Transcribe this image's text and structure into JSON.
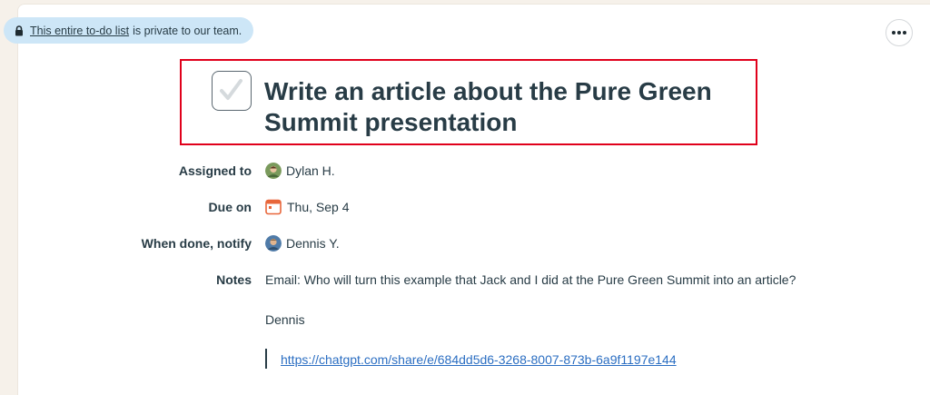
{
  "privacy": {
    "link_text": "This entire to-do list",
    "suffix": "is private to our team."
  },
  "todo": {
    "title": "Write an article about the Pure Green Summit presentation",
    "completed": false
  },
  "fields": {
    "assigned_to": {
      "label": "Assigned to",
      "value": "Dylan H."
    },
    "due_on": {
      "label": "Due on",
      "value": "Thu, Sep 4"
    },
    "notify": {
      "label": "When done, notify",
      "value": "Dennis Y."
    },
    "notes": {
      "label": "Notes",
      "line1": "Email: Who will turn this example that Jack and I did at the Pure Green Summit into an article?",
      "line2": "Dennis",
      "link": "https://chatgpt.com/share/e/684dd5d6-3268-8007-873b-6a9f1197e144"
    }
  },
  "colors": {
    "highlight": "#e0001b",
    "link": "#2b6ec2",
    "calendar": "#e8663a",
    "privacy_bg": "#cde6f7"
  },
  "icons": [
    "lock-icon",
    "more-options-icon",
    "checkmark-icon",
    "calendar-icon"
  ]
}
